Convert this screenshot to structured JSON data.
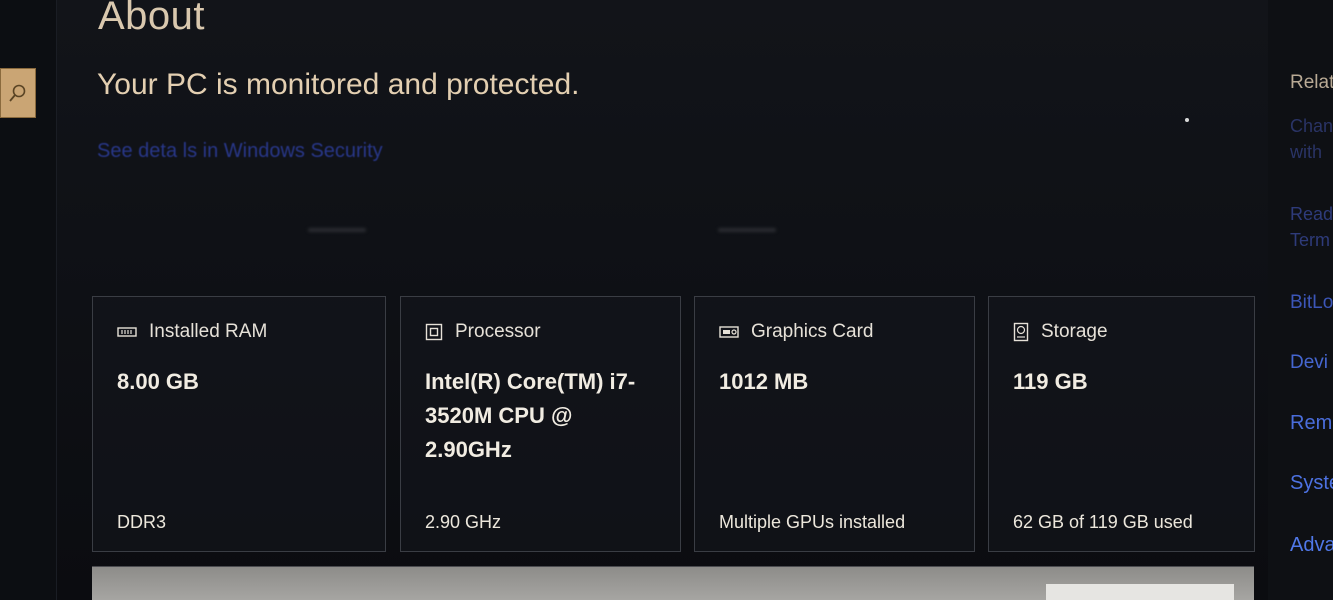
{
  "page": {
    "title": "About",
    "protection_status": "Your PC is monitored and protected.",
    "security_link": "See deta ls in Windows Security"
  },
  "specs": {
    "ram": {
      "label": "Installed RAM",
      "value": "8.00 GB",
      "detail": "DDR3",
      "icon": "memory-icon"
    },
    "processor": {
      "label": "Processor",
      "value": "Intel(R) Core(TM) i7-3520M CPU @ 2.90GHz",
      "detail": "2.90 GHz",
      "icon": "processor-icon"
    },
    "graphics": {
      "label": "Graphics Card",
      "value": "1012 MB",
      "detail": "Multiple GPUs installed",
      "icon": "graphics-card-icon"
    },
    "storage": {
      "label": "Storage",
      "value": "119 GB",
      "detail": "62 GB of 119 GB used",
      "icon": "storage-icon"
    }
  },
  "related": {
    "heading": "Relate",
    "items": [
      "Chan",
      "with",
      "Read",
      "Term",
      "BitLo",
      "Devi",
      "Rem",
      "Syste",
      "Adva"
    ]
  },
  "colors": {
    "accent": "#caa574",
    "link": "#2d3e9e",
    "text_warm": "#e3cfb1",
    "card_border": "#3a3d44",
    "background": "#0f1116"
  }
}
